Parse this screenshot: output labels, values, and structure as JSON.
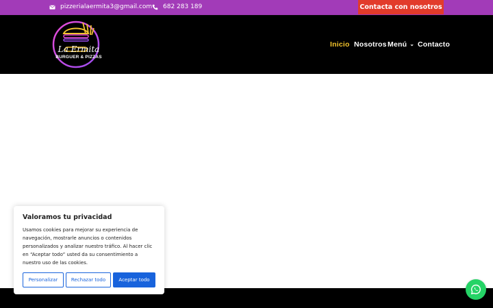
{
  "topbar": {
    "email": "pizzerialaermita3@gmail.com",
    "phone": "682 283 189",
    "cta_label": "Contacta con nosotros",
    "email_icon": "envelope-icon",
    "phone_icon": "phone-icon"
  },
  "header": {
    "logo_name": "La Ermita",
    "logo_tagline": "BURGUER & PIZZAS",
    "nav": [
      {
        "label": "Inicio",
        "active": true
      },
      {
        "label": "Nosotros",
        "active": false
      },
      {
        "label": "Menú",
        "active": false,
        "has_dropdown": true
      },
      {
        "label": "Contacto",
        "active": false
      }
    ]
  },
  "cookie": {
    "title": "Valoramos tu privacidad",
    "text": "Usamos cookies para mejorar su experiencia de navegación, mostrarle anuncios o contenidos personalizados y analizar nuestro tráfico. Al hacer clic en “Aceptar todo” usted da su consentimiento a nuestro uso de las cookies.",
    "customize_label": "Personalizar",
    "reject_label": "Rechazar todo",
    "accept_label": "Aceptar todo"
  },
  "colors": {
    "topbar": "#a23bb8",
    "cta": "#e23b2b",
    "nav_active": "#f5c42c",
    "cookie_accent": "#1863dc",
    "whatsapp": "#25d366"
  },
  "whatsapp_icon": "whatsapp-icon"
}
